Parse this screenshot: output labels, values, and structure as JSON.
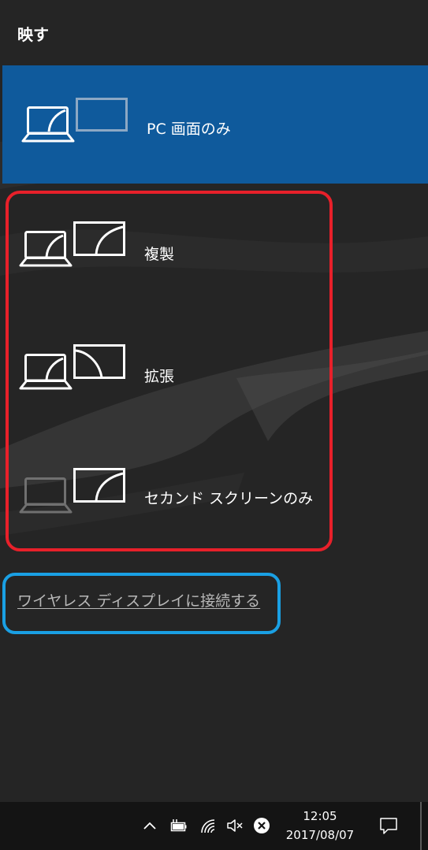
{
  "panel": {
    "title": "映す"
  },
  "options": [
    {
      "label": "PC 画面のみ",
      "selected": true
    },
    {
      "label": "複製",
      "selected": false
    },
    {
      "label": "拡張",
      "selected": false
    },
    {
      "label": "セカンド スクリーンのみ",
      "selected": false
    }
  ],
  "wireless": {
    "link_label": "ワイヤレス ディスプレイに接続する"
  },
  "taskbar": {
    "time": "12:05",
    "date": "2017/08/07"
  },
  "colors": {
    "selected_bg": "#0f5a9c",
    "panel_bg": "#252525",
    "highlight_red": "#e8202a",
    "highlight_blue": "#1aa0e4",
    "link_text": "#b8b8b8"
  },
  "icons": {
    "taskbar": [
      "chevron-up-icon",
      "battery-icon",
      "wifi-icon",
      "volume-muted-icon",
      "close-circle-icon",
      "action-center-icon"
    ]
  }
}
